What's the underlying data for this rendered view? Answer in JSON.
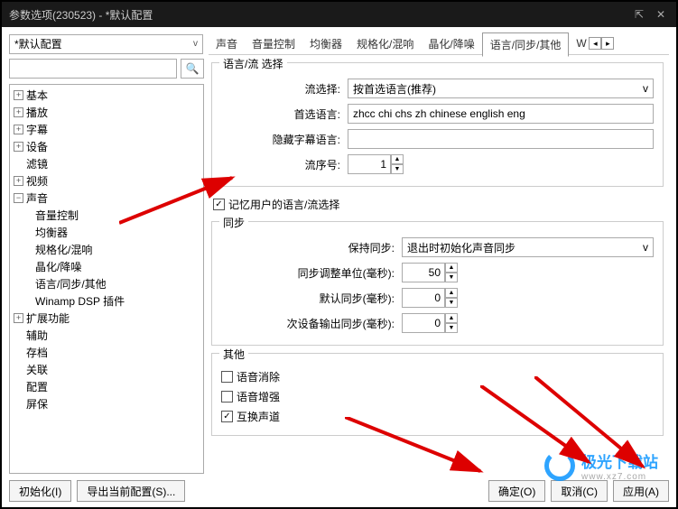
{
  "window": {
    "title": "参数选项(230523) - *默认配置"
  },
  "top_select": {
    "value": "*默认配置",
    "caret": "v"
  },
  "tabs": {
    "items": [
      "声音",
      "音量控制",
      "均衡器",
      "规格化/混响",
      "晶化/降噪",
      "语言/同步/其他",
      "Wi"
    ],
    "active_index": 5,
    "scroll_left": "◂",
    "scroll_right": "▸"
  },
  "search": {
    "placeholder": "",
    "icon": "🔍"
  },
  "tree": [
    {
      "label": "基本",
      "type": "expander",
      "sym": "+"
    },
    {
      "label": "播放",
      "type": "expander",
      "sym": "+"
    },
    {
      "label": "字幕",
      "type": "expander",
      "sym": "+"
    },
    {
      "label": "设备",
      "type": "expander",
      "sym": "+"
    },
    {
      "label": "滤镜",
      "type": "leaf"
    },
    {
      "label": "视频",
      "type": "expander",
      "sym": "+"
    },
    {
      "label": "声音",
      "type": "expander",
      "sym": "−"
    },
    {
      "label": "音量控制",
      "type": "child"
    },
    {
      "label": "均衡器",
      "type": "child"
    },
    {
      "label": "规格化/混响",
      "type": "child"
    },
    {
      "label": "晶化/降噪",
      "type": "child"
    },
    {
      "label": "语言/同步/其他",
      "type": "child"
    },
    {
      "label": "Winamp DSP 插件",
      "type": "child"
    },
    {
      "label": "扩展功能",
      "type": "expander",
      "sym": "+"
    },
    {
      "label": "辅助",
      "type": "leaf"
    },
    {
      "label": "存档",
      "type": "leaf"
    },
    {
      "label": "关联",
      "type": "leaf"
    },
    {
      "label": "配置",
      "type": "leaf"
    },
    {
      "label": "屏保",
      "type": "leaf"
    }
  ],
  "panel": {
    "lang_group": {
      "legend": "语言/流 选择",
      "stream_select_label": "流选择:",
      "stream_select_value": "按首选语言(推荐)",
      "pref_lang_label": "首选语言:",
      "pref_lang_value": "zhcc chi chs zh chinese english eng",
      "hidden_sub_label": "隐藏字幕语言:",
      "hidden_sub_value": "",
      "stream_order_label": "流序号:",
      "stream_order_value": "1"
    },
    "remember": {
      "label": "记忆用户的语言/流选择",
      "checked": true
    },
    "sync_group": {
      "legend": "同步",
      "keep_sync_label": "保持同步:",
      "keep_sync_value": "退出时初始化声音同步",
      "adjust_unit_label": "同步调整单位(毫秒):",
      "adjust_unit_value": "50",
      "default_sync_label": "默认同步(毫秒):",
      "default_sync_value": "0",
      "secondary_out_label": "次设备输出同步(毫秒):",
      "secondary_out_value": "0"
    },
    "other_group": {
      "legend": "其他",
      "voice_cancel": {
        "label": "语音消除",
        "checked": false
      },
      "voice_enhance": {
        "label": "语音增强",
        "checked": false
      },
      "swap_channel": {
        "label": "互换声道",
        "checked": true
      }
    }
  },
  "footer": {
    "init": "初始化(I)",
    "export": "导出当前配置(S)...",
    "ok": "确定(O)",
    "cancel": "取消(C)",
    "apply": "应用(A)"
  },
  "watermark": {
    "brand": "极光下载站",
    "url": "www.xz7.com"
  }
}
